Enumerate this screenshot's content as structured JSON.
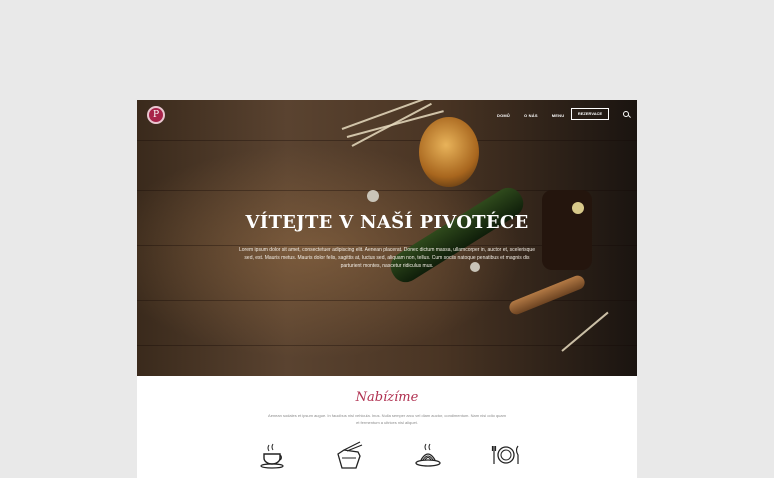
{
  "header": {
    "logo_letter": "P",
    "nav": [
      "DOMŮ",
      "O NÁS",
      "MENU"
    ],
    "cta_label": "REZERVACE"
  },
  "hero": {
    "title": "VÍTEJTE V NAŠÍ PIVOTÉCE",
    "text": "Lorem ipsum dolor sit amet, consectetuer adipiscing elit. Aenean placerat. Donec dictum massa, ullamcorper in, auctor et, scelerisque sed, est. Mauris metus. Mauris dolor felis, sagittis at, luctus sed, aliquam non, tellus. Cum sociis natoque penatibus et magnis dis parturient montes, nascetur ridiculus mus."
  },
  "offers": {
    "title": "Nabízíme",
    "text": "Aenean sodales et ipsum augue. In faucibus nisl vehicula. Inus. Nulla semper arcu vel diam auctor, condimentum. Nam nisi odio quam et fermentum a ultrices nisl aliquet."
  },
  "icons": [
    "coffee-cup-icon",
    "takeaway-box-icon",
    "spaghetti-plate-icon",
    "plate-cutlery-icon"
  ]
}
